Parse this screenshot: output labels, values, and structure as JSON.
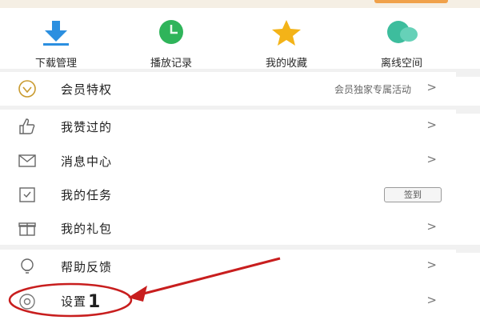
{
  "quick_actions": [
    {
      "label": "下载管理",
      "icon": "download-icon"
    },
    {
      "label": "播放记录",
      "icon": "history-clock-icon"
    },
    {
      "label": "我的收藏",
      "icon": "star-icon"
    },
    {
      "label": "离线空间",
      "icon": "cloud-icon"
    }
  ],
  "menu": {
    "vip": {
      "label": "会员特权",
      "sub": "会员独家专属活动",
      "icon": "vip-badge-icon"
    },
    "liked": {
      "label": "我赞过的",
      "icon": "thumbs-up-icon"
    },
    "messages": {
      "label": "消息中心",
      "icon": "envelope-icon"
    },
    "tasks": {
      "label": "我的任务",
      "badge": "签到",
      "icon": "task-calendar-icon"
    },
    "gifts": {
      "label": "我的礼包",
      "icon": "gift-icon"
    },
    "feedback": {
      "label": "帮助反馈",
      "icon": "lightbulb-icon"
    },
    "settings": {
      "label": "设置",
      "annotation": "1",
      "icon": "gear-icon"
    }
  },
  "chevron": ">",
  "colors": {
    "accent_blue": "#2b8fe0",
    "accent_green": "#2fb45a",
    "accent_yellow": "#f3b318",
    "accent_teal": "#3dbd9d",
    "annotation_red": "#c81e1e"
  }
}
